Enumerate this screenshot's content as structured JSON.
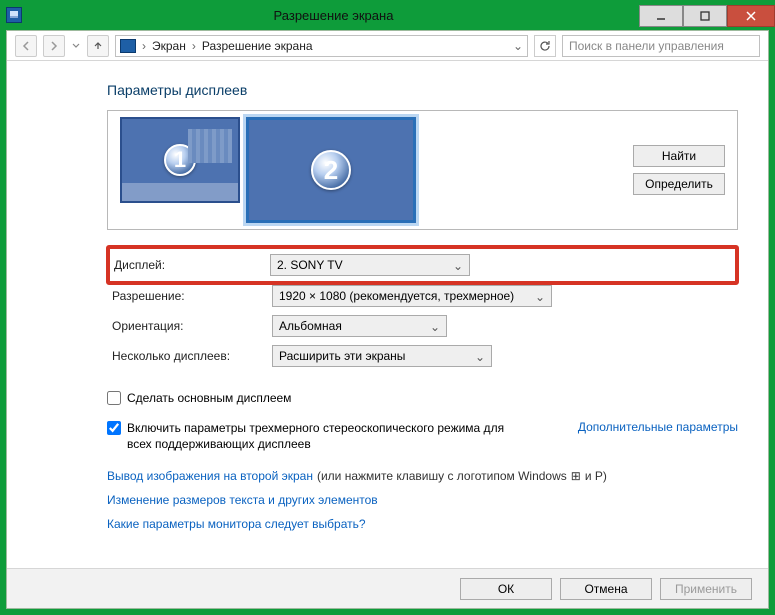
{
  "window": {
    "title": "Разрешение экрана",
    "breadcrumbs": {
      "root": "Экран",
      "current": "Разрешение экрана"
    },
    "search_placeholder": "Поиск в панели управления"
  },
  "heading": "Параметры дисплеев",
  "preview": {
    "display1_num": "1",
    "display2_num": "2",
    "btn_find": "Найти",
    "btn_identify": "Определить"
  },
  "fields": {
    "display_label": "Дисплей:",
    "display_value": "2. SONY TV",
    "resolution_label": "Разрешение:",
    "resolution_value": "1920 × 1080 (рекомендуется, трехмерное)",
    "orientation_label": "Ориентация:",
    "orientation_value": "Альбомная",
    "multi_label": "Несколько дисплеев:",
    "multi_value": "Расширить эти экраны"
  },
  "checkboxes": {
    "make_primary": "Сделать основным дисплеем",
    "stereo": "Включить параметры трехмерного стереоскопического режима для всех поддерживающих дисплеев"
  },
  "links": {
    "advanced": "Дополнительные параметры",
    "project": "Вывод изображения на второй экран",
    "project_suffix": " (или нажмите клавишу с логотипом Windows ",
    "project_key": "⊞",
    "project_and": " и P)",
    "textsize": "Изменение размеров текста и других элементов",
    "help": "Какие параметры монитора следует выбрать?"
  },
  "footer": {
    "ok": "ОК",
    "cancel": "Отмена",
    "apply": "Применить"
  }
}
